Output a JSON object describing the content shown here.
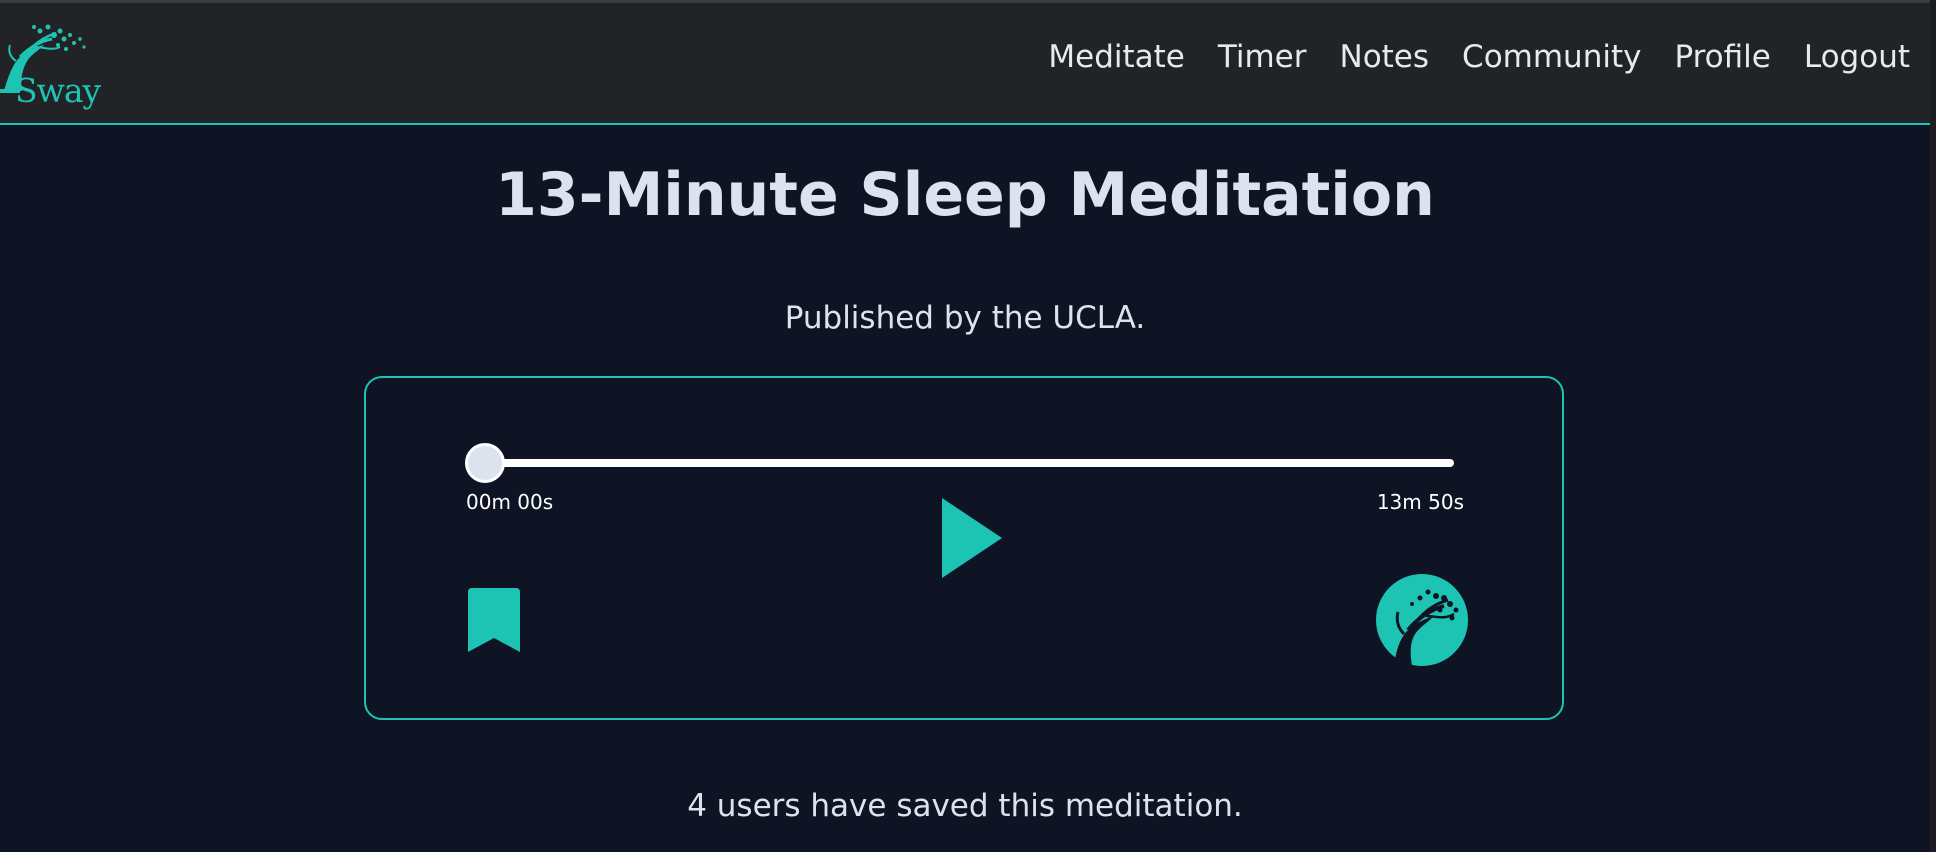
{
  "brand": {
    "name": "Sway",
    "accent_color": "#1ec4b3",
    "logo_icon": "windblown-tree-icon"
  },
  "nav": {
    "items": [
      {
        "label": "Meditate"
      },
      {
        "label": "Timer"
      },
      {
        "label": "Notes"
      },
      {
        "label": "Community"
      },
      {
        "label": "Profile"
      },
      {
        "label": "Logout"
      }
    ]
  },
  "meditation": {
    "title": "13-Minute Sleep Meditation",
    "publisher": "Published by the UCLA.",
    "saved_text": "4 users have saved this meditation."
  },
  "player": {
    "current_time": "00m 00s",
    "duration": "13m 50s",
    "progress": 0,
    "play_icon": "play-icon",
    "bookmark_icon": "bookmark-icon",
    "badge_icon": "tree-badge-icon"
  }
}
